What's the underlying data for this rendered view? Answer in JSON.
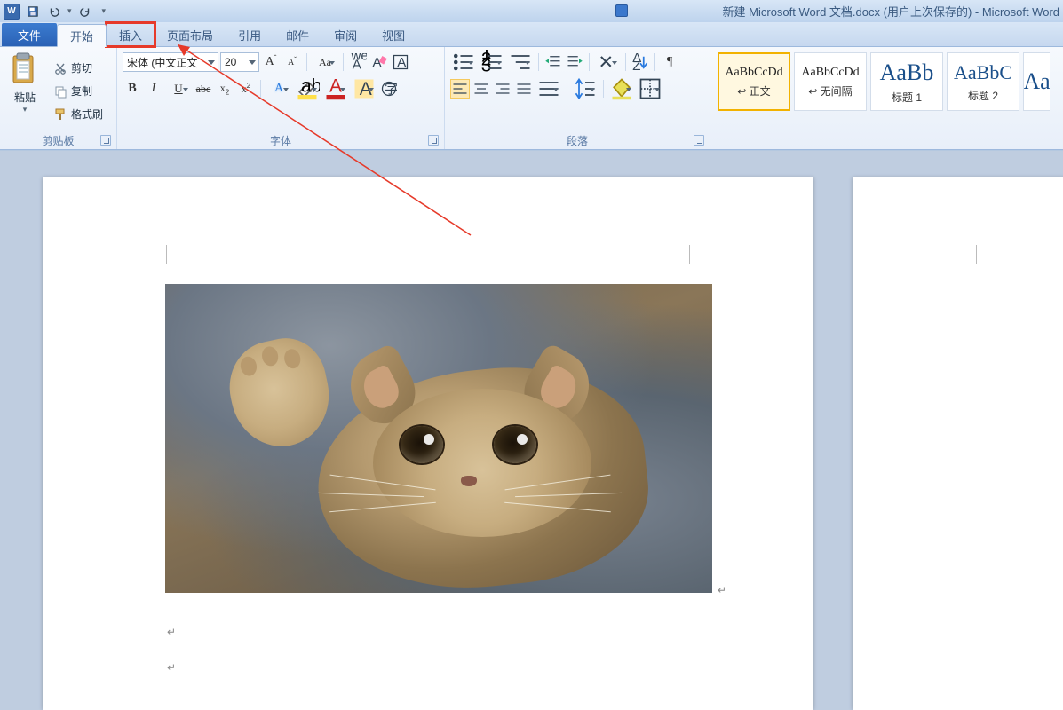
{
  "titlebar": {
    "word_icon": "W",
    "doc_title": "新建 Microsoft Word 文档.docx (用户上次保存的) - Microsoft Word"
  },
  "tabs": {
    "file": "文件",
    "items": [
      "开始",
      "插入",
      "页面布局",
      "引用",
      "邮件",
      "审阅",
      "视图"
    ],
    "active_index": 0,
    "highlight_index": 1
  },
  "clipboard": {
    "label": "剪贴板",
    "paste": "粘贴",
    "cut": "剪切",
    "copy": "复制",
    "format_painter": "格式刷"
  },
  "font": {
    "label": "字体",
    "name": "宋体 (中文正文",
    "size": "20"
  },
  "paragraph": {
    "label": "段落"
  },
  "styles": {
    "items": [
      {
        "sample": "AaBbCcDd",
        "name": "↩ 正文",
        "selected": true,
        "cls": "sample"
      },
      {
        "sample": "AaBbCcDd",
        "name": "↩ 无间隔",
        "selected": false,
        "cls": "sample"
      },
      {
        "sample": "AaBb",
        "name": "标题 1",
        "selected": false,
        "cls": "sample big"
      },
      {
        "sample": "AaBbC",
        "name": "标题 2",
        "selected": false,
        "cls": "sample big2"
      },
      {
        "sample": "Aa",
        "name": "",
        "selected": false,
        "cls": "sample big"
      }
    ]
  }
}
